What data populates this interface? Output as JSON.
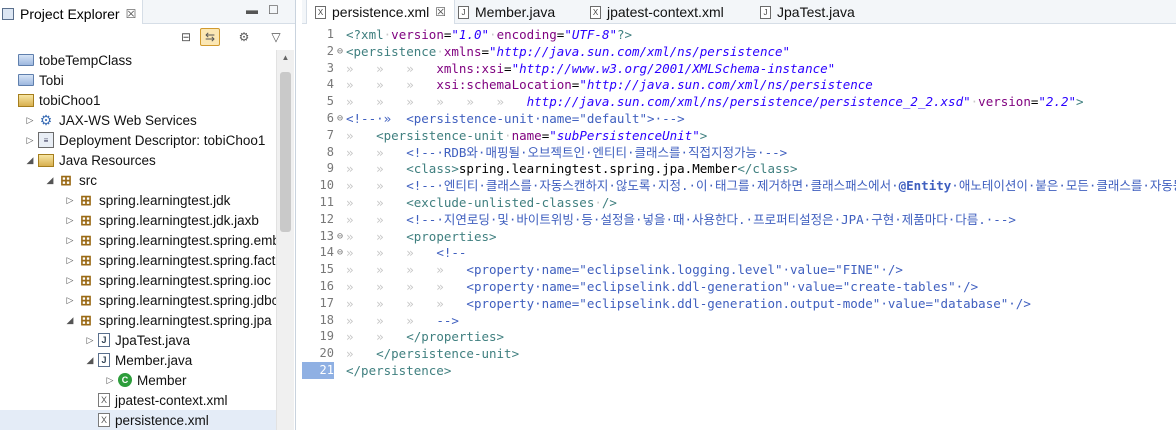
{
  "explorer": {
    "tab_title": "Project Explorer",
    "tab_close": "☒",
    "minimize": "▬",
    "maximize": "☐",
    "toolbar_icons": [
      "collapse-all-icon",
      "link-with-editor-icon",
      "filter-icon",
      "view-menu-icon"
    ],
    "tree": [
      {
        "label": "tobeTempClass",
        "icon": "folder",
        "depth": 0,
        "twisty": ""
      },
      {
        "label": "Tobi",
        "icon": "folder",
        "depth": 0,
        "twisty": ""
      },
      {
        "label": "tobiChoo1",
        "icon": "project",
        "depth": 0,
        "twisty": ""
      },
      {
        "label": "JAX-WS Web Services",
        "icon": "ws",
        "depth": 1,
        "twisty": "▷"
      },
      {
        "label": "Deployment Descriptor: tobiChoo1",
        "icon": "dd",
        "depth": 1,
        "twisty": "▷"
      },
      {
        "label": "Java Resources",
        "icon": "project",
        "depth": 1,
        "twisty": "◢"
      },
      {
        "label": "src",
        "icon": "pkg",
        "depth": 2,
        "twisty": "◢"
      },
      {
        "label": "spring.learningtest.jdk",
        "icon": "pkg",
        "depth": 3,
        "twisty": "▷"
      },
      {
        "label": "spring.learningtest.jdk.jaxb",
        "icon": "pkg",
        "depth": 3,
        "twisty": "▷"
      },
      {
        "label": "spring.learningtest.spring.emb",
        "icon": "pkg",
        "depth": 3,
        "twisty": "▷"
      },
      {
        "label": "spring.learningtest.spring.factc",
        "icon": "pkg",
        "depth": 3,
        "twisty": "▷"
      },
      {
        "label": "spring.learningtest.spring.ioc",
        "icon": "pkg",
        "depth": 3,
        "twisty": "▷"
      },
      {
        "label": "spring.learningtest.spring.jdbc",
        "icon": "pkg",
        "depth": 3,
        "twisty": "▷"
      },
      {
        "label": "spring.learningtest.spring.jpa",
        "icon": "pkg",
        "depth": 3,
        "twisty": "◢"
      },
      {
        "label": "JpaTest.java",
        "icon": "java",
        "depth": 4,
        "twisty": "▷"
      },
      {
        "label": "Member.java",
        "icon": "java",
        "depth": 4,
        "twisty": "◢"
      },
      {
        "label": "Member",
        "icon": "class",
        "depth": 5,
        "twisty": "▷"
      },
      {
        "label": "jpatest-context.xml",
        "icon": "xml",
        "depth": 4,
        "twisty": ""
      },
      {
        "label": "persistence.xml",
        "icon": "xml",
        "depth": 4,
        "twisty": "",
        "selected": true
      }
    ]
  },
  "editor": {
    "tabs": [
      {
        "label": "persistence.xml",
        "icon": "X",
        "active": true,
        "close": "☒"
      },
      {
        "label": "Member.java",
        "icon": "J",
        "active": false
      },
      {
        "label": "jpatest-context.xml",
        "icon": "X",
        "active": false
      },
      {
        "label": "JpaTest.java",
        "icon": "J",
        "active": false
      }
    ],
    "lines": [
      {
        "n": "1",
        "fold": "",
        "segs": [
          [
            "pi",
            "<?xml"
          ],
          [
            "ws",
            "·"
          ],
          [
            "attr",
            "version"
          ],
          [
            "txt",
            "="
          ],
          [
            "val",
            "\"1.0\""
          ],
          [
            "ws",
            "·"
          ],
          [
            "attr",
            "encoding"
          ],
          [
            "txt",
            "="
          ],
          [
            "val",
            "\"UTF-8\""
          ],
          [
            "pi",
            "?>"
          ]
        ]
      },
      {
        "n": "2",
        "fold": "⊖",
        "segs": [
          [
            "tag",
            "<persistence"
          ],
          [
            "ws",
            "·"
          ],
          [
            "attr",
            "xmlns"
          ],
          [
            "txt",
            "="
          ],
          [
            "val",
            "\"http://java.sun.com/xml/ns/persistence\""
          ]
        ]
      },
      {
        "n": "3",
        "fold": "",
        "segs": [
          [
            "ws",
            "»   »   »   "
          ],
          [
            "attr",
            "xmlns:xsi"
          ],
          [
            "txt",
            "="
          ],
          [
            "val",
            "\"http://www.w3.org/2001/XMLSchema-instance\""
          ]
        ]
      },
      {
        "n": "4",
        "fold": "",
        "segs": [
          [
            "ws",
            "»   »   »   "
          ],
          [
            "attr",
            "xsi:schemaLocation"
          ],
          [
            "txt",
            "="
          ],
          [
            "val",
            "\"http://java.sun.com/xml/ns/persistence"
          ]
        ]
      },
      {
        "n": "5",
        "fold": "",
        "segs": [
          [
            "ws",
            "»   »   »   »   »   »   "
          ],
          [
            "val",
            "http://java.sun.com/xml/ns/persistence/persistence_2_2.xsd\""
          ],
          [
            "ws",
            "·"
          ],
          [
            "attr",
            "version"
          ],
          [
            "txt",
            "="
          ],
          [
            "val",
            "\"2.2\""
          ],
          [
            "tag",
            ">"
          ]
        ]
      },
      {
        "n": "6",
        "fold": "⊖",
        "segs": [
          [
            "cmt",
            "<!--·»  "
          ],
          [
            "cmt",
            "<persistence-unit·name=\"default\">·-->"
          ]
        ]
      },
      {
        "n": "7",
        "fold": "",
        "segs": [
          [
            "ws",
            "»   "
          ],
          [
            "tag",
            "<persistence-unit"
          ],
          [
            "ws",
            "·"
          ],
          [
            "attr",
            "name"
          ],
          [
            "txt",
            "="
          ],
          [
            "val",
            "\"subPersistenceUnit\""
          ],
          [
            "tag",
            ">"
          ]
        ]
      },
      {
        "n": "8",
        "fold": "",
        "segs": [
          [
            "ws",
            "»   »   "
          ],
          [
            "cmt",
            "<!--·RDB와·매핑될·오브젝트인·엔티티·클래스를·직접지정가능·-->"
          ]
        ]
      },
      {
        "n": "9",
        "fold": "",
        "segs": [
          [
            "ws",
            "»   »   "
          ],
          [
            "tag",
            "<class>"
          ],
          [
            "txt",
            "spring.learningtest.spring.jpa.Member"
          ],
          [
            "tag",
            "</class>"
          ]
        ]
      },
      {
        "n": "10",
        "fold": "",
        "segs": [
          [
            "ws",
            "»   »   "
          ],
          [
            "cmt",
            "<!--·엔티티·클래스를·자동스캔하지·않도록·지정.·이·태그를·제거하면·클래스패스에서·"
          ],
          [
            "cmtb",
            "@Entity"
          ],
          [
            "cmt",
            "·애노테이션이·붙은·모든·클래스를·자동등록·-->"
          ]
        ]
      },
      {
        "n": "11",
        "fold": "",
        "segs": [
          [
            "ws",
            "»   »   "
          ],
          [
            "tag",
            "<exclude-unlisted-classes"
          ],
          [
            "ws",
            "·"
          ],
          [
            "tag",
            "/>"
          ]
        ]
      },
      {
        "n": "12",
        "fold": "",
        "segs": [
          [
            "ws",
            "»   »   "
          ],
          [
            "cmt",
            "<!--·지연로딩·및·바이트위빙·등·설정을·넣을·때·사용한다.·프로퍼티설정은·JPA·구현·제품마다·다름.·-->"
          ]
        ]
      },
      {
        "n": "13",
        "fold": "⊖",
        "segs": [
          [
            "ws",
            "»   »   "
          ],
          [
            "tag",
            "<properties>"
          ]
        ]
      },
      {
        "n": "14",
        "fold": "⊖",
        "segs": [
          [
            "ws",
            "»   »   »   "
          ],
          [
            "cmt",
            "<!--"
          ]
        ]
      },
      {
        "n": "15",
        "fold": "",
        "segs": [
          [
            "ws",
            "»   »   »   »   "
          ],
          [
            "cmt",
            "<property·name=\"eclipselink.logging.level\"·value=\"FINE\"·/>"
          ]
        ]
      },
      {
        "n": "16",
        "fold": "",
        "segs": [
          [
            "ws",
            "»   »   »   »   "
          ],
          [
            "cmt",
            "<property·name=\"eclipselink.ddl-generation\"·value=\"create-tables\"·/>"
          ]
        ]
      },
      {
        "n": "17",
        "fold": "",
        "segs": [
          [
            "ws",
            "»   »   »   »   "
          ],
          [
            "cmt",
            "<property·name=\"eclipselink.ddl-generation.output-mode\"·value=\"database\"·/>"
          ]
        ]
      },
      {
        "n": "18",
        "fold": "",
        "segs": [
          [
            "ws",
            "»   »   »   "
          ],
          [
            "cmt",
            "-->"
          ]
        ]
      },
      {
        "n": "19",
        "fold": "",
        "segs": [
          [
            "ws",
            "»   »   "
          ],
          [
            "tag",
            "</properties>"
          ]
        ]
      },
      {
        "n": "20",
        "fold": "",
        "segs": [
          [
            "ws",
            "»   "
          ],
          [
            "tag",
            "</persistence-unit>"
          ]
        ]
      },
      {
        "n": "21",
        "fold": "",
        "current": true,
        "segs": [
          [
            "tag",
            "</persistence>"
          ]
        ]
      }
    ]
  }
}
